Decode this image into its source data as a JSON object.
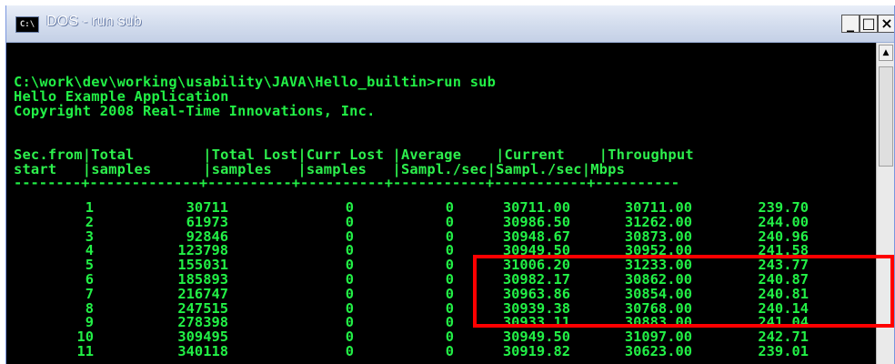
{
  "window": {
    "icon_text": "C:\\",
    "title": "DOS - run sub",
    "minimize_glyph": "_",
    "maximize_glyph": "□",
    "close_glyph": "×",
    "scroll_up_glyph": "▲"
  },
  "console": {
    "command_line": "C:\\work\\dev\\working\\usability\\JAVA\\Hello_builtin>run sub",
    "app_line": "Hello Example Application",
    "copyright_line": "Copyright 2008 Real-Time Innovations, Inc.",
    "header_row1": "Sec.from|Total        |Total Lost|Curr Lost |Average    |Current    |Throughput",
    "header_row2": "start   |samples      |samples   |samples   |Sampl./sec|Sampl./sec|Mbps",
    "separator": "--------+-------------+----------+----------+-----------+-----------+----------"
  },
  "table": {
    "rows": [
      {
        "sec": "1",
        "total": "30711",
        "lost": "0",
        "curr_lost": "0",
        "avg": "30711.00",
        "cur": "30711.00",
        "mbps": "239.70"
      },
      {
        "sec": "2",
        "total": "61973",
        "lost": "0",
        "curr_lost": "0",
        "avg": "30986.50",
        "cur": "31262.00",
        "mbps": "244.00"
      },
      {
        "sec": "3",
        "total": "92846",
        "lost": "0",
        "curr_lost": "0",
        "avg": "30948.67",
        "cur": "30873.00",
        "mbps": "240.96"
      },
      {
        "sec": "4",
        "total": "123798",
        "lost": "0",
        "curr_lost": "0",
        "avg": "30949.50",
        "cur": "30952.00",
        "mbps": "241.58"
      },
      {
        "sec": "5",
        "total": "155031",
        "lost": "0",
        "curr_lost": "0",
        "avg": "31006.20",
        "cur": "31233.00",
        "mbps": "243.77"
      },
      {
        "sec": "6",
        "total": "185893",
        "lost": "0",
        "curr_lost": "0",
        "avg": "30982.17",
        "cur": "30862.00",
        "mbps": "240.87"
      },
      {
        "sec": "7",
        "total": "216747",
        "lost": "0",
        "curr_lost": "0",
        "avg": "30963.86",
        "cur": "30854.00",
        "mbps": "240.81"
      },
      {
        "sec": "8",
        "total": "247515",
        "lost": "0",
        "curr_lost": "0",
        "avg": "30939.38",
        "cur": "30768.00",
        "mbps": "240.14"
      },
      {
        "sec": "9",
        "total": "278398",
        "lost": "0",
        "curr_lost": "0",
        "avg": "30933.11",
        "cur": "30883.00",
        "mbps": "241.04"
      },
      {
        "sec": "10",
        "total": "309495",
        "lost": "0",
        "curr_lost": "0",
        "avg": "30949.50",
        "cur": "31097.00",
        "mbps": "242.71"
      },
      {
        "sec": "11",
        "total": "340118",
        "lost": "0",
        "curr_lost": "0",
        "avg": "30919.82",
        "cur": "30623.00",
        "mbps": "239.01"
      }
    ]
  },
  "colors": {
    "console_text": "#22f046",
    "console_bg": "#000000",
    "highlight": "#ff0000"
  }
}
